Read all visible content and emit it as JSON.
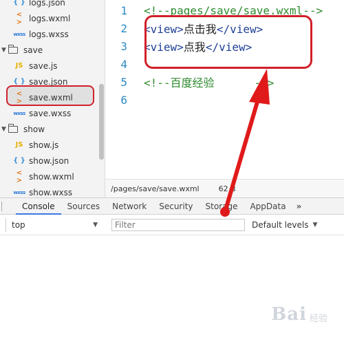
{
  "file_tree": {
    "rows": [
      {
        "kind": "file",
        "icon": "json-icon",
        "glyph": "{ }",
        "name": "logs.json",
        "depth": 1
      },
      {
        "kind": "file",
        "icon": "wxml-icon",
        "glyph": "< >",
        "name": "logs.wxml",
        "depth": 1
      },
      {
        "kind": "file",
        "icon": "wxss-icon",
        "glyph": "wxss",
        "name": "logs.wxss",
        "depth": 1
      },
      {
        "kind": "folder",
        "name": "save"
      },
      {
        "kind": "file",
        "icon": "js-icon",
        "glyph": "JS",
        "name": "save.js",
        "depth": 1
      },
      {
        "kind": "file",
        "icon": "json-icon",
        "glyph": "{ }",
        "name": "save.json",
        "depth": 1
      },
      {
        "kind": "file",
        "icon": "wxml-icon",
        "glyph": "< >",
        "name": "save.wxml",
        "depth": 1,
        "selected": true
      },
      {
        "kind": "file",
        "icon": "wxss-icon",
        "glyph": "wxss",
        "name": "save.wxss",
        "depth": 1
      },
      {
        "kind": "folder",
        "name": "show"
      },
      {
        "kind": "file",
        "icon": "js-icon",
        "glyph": "JS",
        "name": "show.js",
        "depth": 1
      },
      {
        "kind": "file",
        "icon": "json-icon",
        "glyph": "{ }",
        "name": "show.json",
        "depth": 1
      },
      {
        "kind": "file",
        "icon": "wxml-icon",
        "glyph": "< >",
        "name": "show.wxml",
        "depth": 1
      },
      {
        "kind": "file",
        "icon": "wxss-icon",
        "glyph": "wxss",
        "name": "show.wxss",
        "depth": 1
      }
    ]
  },
  "editor": {
    "lines": [
      {
        "num": "1",
        "text": "<!--pages/save/save.wxml-->",
        "type": "comment"
      },
      {
        "num": "2",
        "open": "<view>",
        "inner": "点击我",
        "close": "</view>",
        "type": "code"
      },
      {
        "num": "3",
        "open": "<view>",
        "inner": "点我",
        "close": "</view>",
        "type": "code"
      },
      {
        "num": "4",
        "text": "",
        "type": "comment"
      },
      {
        "num": "5",
        "text": "<!--百度经验      -->",
        "type": "comment"
      },
      {
        "num": "6",
        "text": "",
        "type": "comment"
      }
    ]
  },
  "status_bar": {
    "path": "/pages/save/save.wxml",
    "size": "62 B"
  },
  "devtools": {
    "tabs": [
      "Console",
      "Sources",
      "Network",
      "Security",
      "Storage",
      "AppData"
    ],
    "active_tab": "Console",
    "more_label": "»",
    "context": "top",
    "filter_placeholder": "Filter",
    "levels_label": "Default levels"
  },
  "watermark": {
    "brand": "Bai",
    "sub": "经验"
  },
  "colors": {
    "highlight": "#d0202a",
    "line_number": "#2b8ac4",
    "tag": "#1f3f95",
    "comment": "#2e8a2e",
    "active_tab": "#3b78e7"
  }
}
